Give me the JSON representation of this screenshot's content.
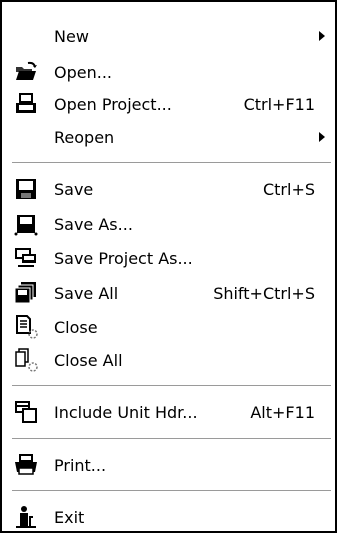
{
  "menu": {
    "items": [
      {
        "label": "New",
        "icon": "none",
        "has_submenu": true
      },
      {
        "label": "Open...",
        "icon": "open-folder-icon"
      },
      {
        "label": "Open Project...",
        "shortcut": "Ctrl+F11",
        "icon": "open-project-icon"
      },
      {
        "label": "Reopen",
        "icon": "none",
        "has_submenu": true
      },
      {
        "label": "Save",
        "shortcut": "Ctrl+S",
        "icon": "save-icon"
      },
      {
        "label": "Save As...",
        "icon": "save-as-icon"
      },
      {
        "label": "Save Project As...",
        "icon": "save-project-as-icon"
      },
      {
        "label": "Save All",
        "shortcut": "Shift+Ctrl+S",
        "icon": "save-all-icon"
      },
      {
        "label": "Close",
        "icon": "close-file-icon"
      },
      {
        "label": "Close All",
        "icon": "close-all-icon"
      },
      {
        "label": "Include Unit Hdr...",
        "shortcut": "Alt+F11",
        "icon": "include-unit-icon"
      },
      {
        "label": "Print...",
        "icon": "printer-icon"
      },
      {
        "label": "Exit",
        "icon": "exit-icon"
      }
    ]
  }
}
